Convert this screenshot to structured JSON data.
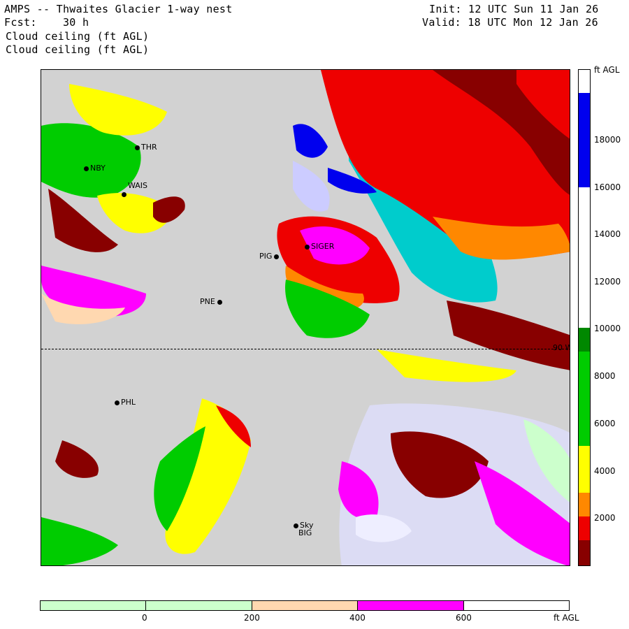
{
  "header": {
    "title": "AMPS -- Thwaites Glacier 1-way nest",
    "fcst": "Fcst:    30 h",
    "field1": "Cloud ceiling (ft AGL)",
    "field2": "Cloud ceiling (ft AGL)",
    "init": "Init: 12 UTC Sun 11 Jan 26",
    "valid": "Valid: 18 UTC Mon 12 Jan 26"
  },
  "stations": [
    {
      "name": "THR"
    },
    {
      "name": "NBY"
    },
    {
      "name": "WAIS"
    },
    {
      "name": "SIGER"
    },
    {
      "name": "PIG"
    },
    {
      "name": "PNE"
    },
    {
      "name": "PHL"
    },
    {
      "name": "Sky"
    },
    {
      "name": "BIG"
    }
  ],
  "meridian_label": "90 W",
  "colorbar": {
    "unit": "ft AGL",
    "labels": [
      "18000",
      "16000",
      "14000",
      "12000",
      "10000",
      "8000",
      "6000",
      "4000",
      "2000"
    ],
    "colors": {
      "above18000": "#ffffff",
      "blue": "#0000ee",
      "white": "#ffffff",
      "dkgreen": "#008800",
      "green": "#00cc00",
      "yellow": "#ffff00",
      "orange": "#ff8800",
      "red": "#ee0000",
      "maroon": "#880000"
    }
  },
  "hbar": {
    "unit": "ft AGL",
    "labels": [
      "0",
      "200",
      "400",
      "600"
    ],
    "colors": {
      "lightgreen": "#ccffcc",
      "peach": "#ffd8b0",
      "magenta": "#ff00ff",
      "white": "#ffffff"
    }
  }
}
